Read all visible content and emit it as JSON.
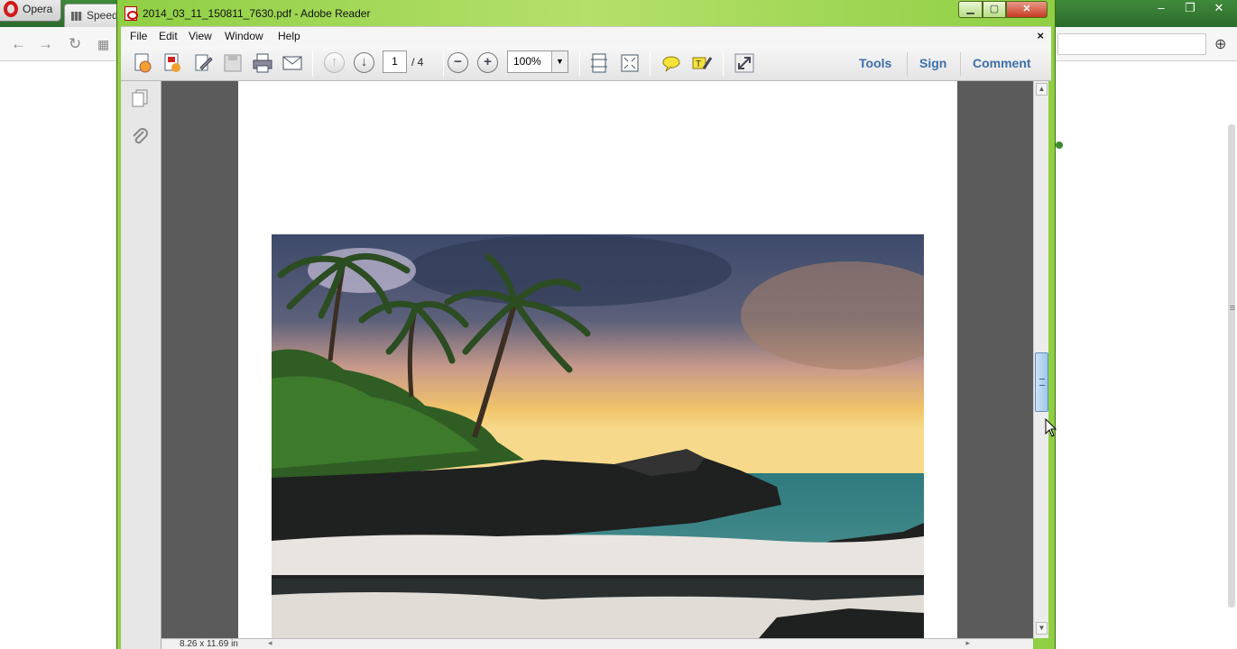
{
  "opera": {
    "menu_label": "Opera",
    "tab_label": "Speed",
    "window_controls": [
      "–",
      "❐",
      "✕"
    ]
  },
  "reader": {
    "title": "2014_03_11_150811_7630.pdf - Adobe Reader",
    "menu": [
      "File",
      "Edit",
      "View",
      "Window",
      "Help"
    ],
    "close_doc": "×",
    "page_current": "1",
    "page_total": "/ 4",
    "zoom": "100%",
    "tabs": {
      "tools": "Tools",
      "sign": "Sign",
      "comment": "Comment"
    },
    "status_size": "8.26 x 11.69 in",
    "icons": {
      "create": "create-pdf-icon",
      "export": "export-pdf-icon",
      "edit": "edit-icon",
      "save": "save-icon",
      "print": "print-icon",
      "email": "email-icon",
      "prev": "previous-page-icon",
      "next": "next-page-icon",
      "zoom_out": "zoom-out-icon",
      "zoom_in": "zoom-in-icon",
      "fit_width": "fit-width-icon",
      "fit_page": "fit-page-icon",
      "comment": "sticky-note-icon",
      "highlight": "highlight-icon",
      "fullscreen": "full-screen-icon"
    }
  }
}
